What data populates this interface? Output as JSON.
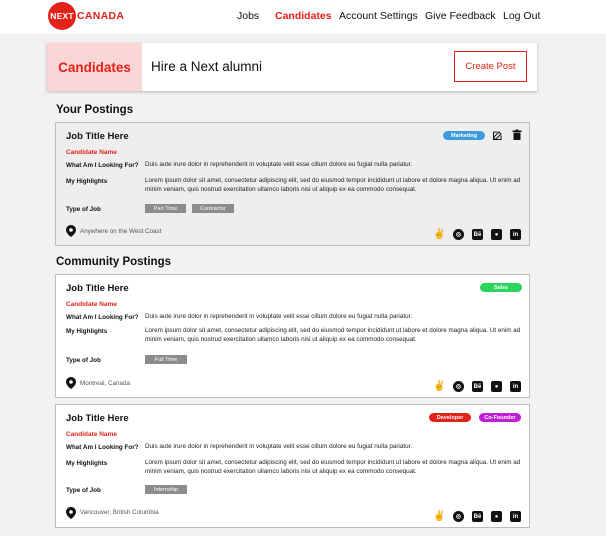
{
  "nav": {
    "logo_mark": "NEXT",
    "logo_word": "CANADA",
    "items": [
      {
        "label": "Jobs"
      },
      {
        "label": "Candidates"
      },
      {
        "label": "Account Settings"
      },
      {
        "label": "Give Feedback"
      },
      {
        "label": "Log Out"
      }
    ]
  },
  "banner": {
    "tag": "Candidates",
    "title": "Hire a Next alumni",
    "create_label": "Create Post"
  },
  "sections": {
    "yours": "Your Postings",
    "community": "Community Postings"
  },
  "labels": {
    "looking_for": "What Am I Looking For?",
    "highlights": "My Highlights",
    "type_of_job": "Type of Job"
  },
  "colors": {
    "accent": "#e2231a",
    "marketing": "#3d9bdc",
    "sales": "#2bd45b",
    "developer": "#e2231a",
    "cofounder": "#c11fd6"
  },
  "postings": [
    {
      "job_title": "Job Title Here",
      "candidate": "Candidate Name",
      "looking_for": "Duis aute irure dolor in reprehenderit in voluptate velit esse cillum dolore eu fugiat nulla pariatur.",
      "highlights": "Lorem ipsum dolor sit amet, consectetur adipiscing elit, sed do eiusmod tempor incididunt ut labore et dolore magna aliqua. Ut enim ad minim veniam, quis nostrud exercitation ullamco laboris nisi ut aliquip ex ea commodo consequat.",
      "types": [
        "Part Time",
        "Contractor"
      ],
      "badges": [
        "Marketing"
      ],
      "location": "Anywhere on the West Coast"
    },
    {
      "job_title": "Job Title Here",
      "candidate": "Candidate Name",
      "looking_for": "Duis aute irure dolor in reprehenderit in voluptate velit esse cillum dolore eu fugiat nulla pariatur.",
      "highlights": "Lorem ipsum dolor sit amet, consectetur adipiscing elit, sed do eiusmod tempor incididunt ut labore et dolore magna aliqua. Ut enim ad minim veniam, quis nostrud exercitation ullamco laboris nisi ut aliquip ex ea commodo consequat.",
      "types": [
        "Full Time"
      ],
      "badges": [
        "Sales"
      ],
      "location": "Montreal, Canada"
    },
    {
      "job_title": "Job Title Here",
      "candidate": "Candidate Name",
      "looking_for": "Duis aute irure dolor in reprehenderit in voluptate velit esse cillum dolore eu fugiat nulla pariatur.",
      "highlights": "Lorem ipsum dolor sit amet, consectetur adipiscing elit, sed do eiusmod tempor incididunt ut labore et dolore magna aliqua. Ut enim ad minim veniam, quis nostrud exercitation ullamco laboris nisi ut aliquip ex ea commodo consequat.",
      "types": [
        "Internship"
      ],
      "badges": [
        "Developer",
        "Co-Founder"
      ],
      "location": "Vancouver, British Columbia"
    }
  ],
  "socials": {
    "behance": "Bē",
    "github": "",
    "linkedin": "in"
  }
}
